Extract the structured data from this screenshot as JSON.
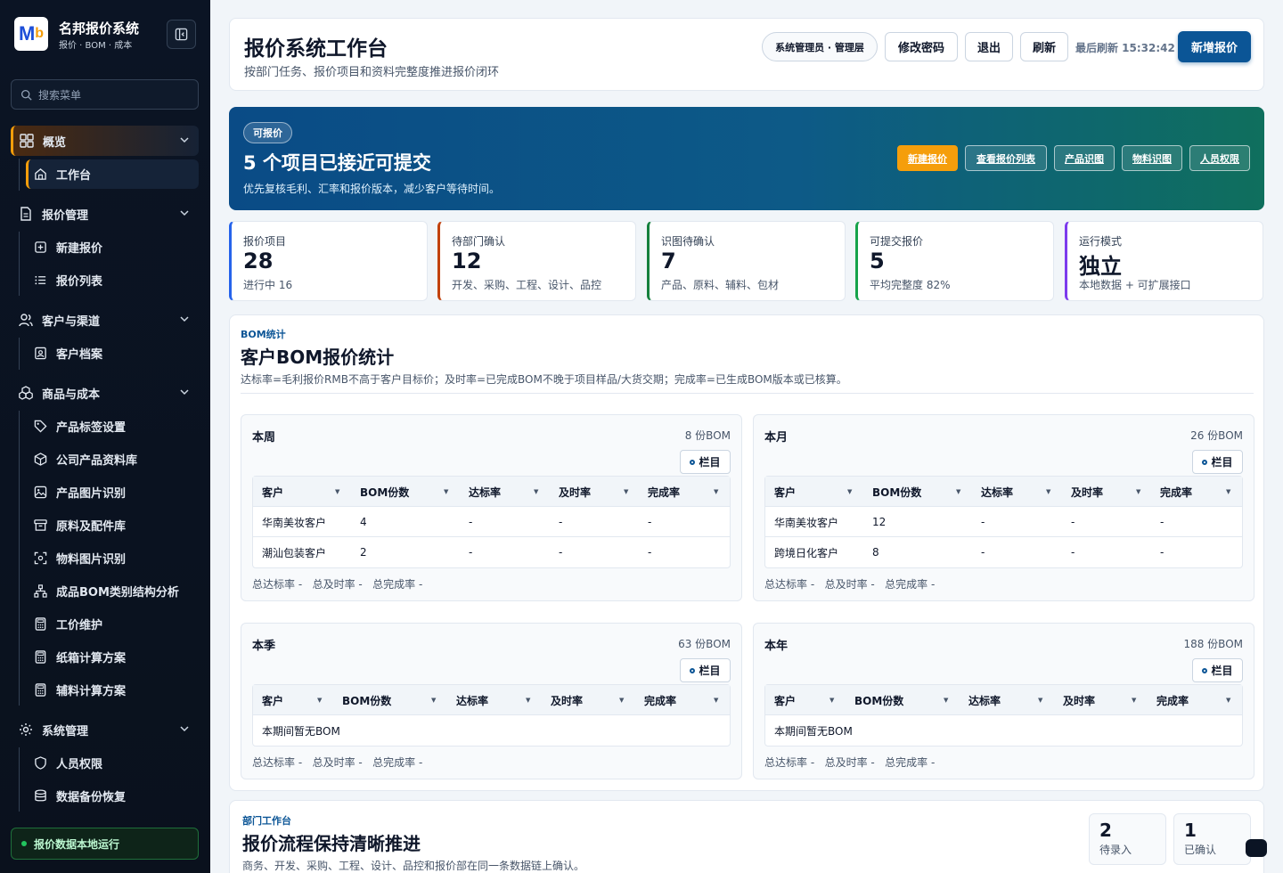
{
  "brand": {
    "name": "名邦报价系统",
    "sub": "报价 · BOM · 成本",
    "logo_main": "M",
    "logo_accent": "b"
  },
  "search": {
    "placeholder": "搜索菜单"
  },
  "nav": {
    "overview": "概览",
    "workbench": "工作台",
    "quote_mgmt": "报价管理",
    "new_quote": "新建报价",
    "quote_list": "报价列表",
    "customer": "客户与渠道",
    "customer_files": "客户档案",
    "goods": "商品与成本",
    "tags": "产品标签设置",
    "product_lib": "公司产品资料库",
    "product_img": "产品图片识别",
    "materials": "原料及配件库",
    "material_img": "物料图片识别",
    "bom_analysis": "成品BOM类别结构分析",
    "labor": "工价维护",
    "carton": "纸箱计算方案",
    "aux": "辅料计算方案",
    "system": "系统管理",
    "perm": "人员权限",
    "backup": "数据备份恢复"
  },
  "status_footer": "报价数据本地运行",
  "header": {
    "title": "报价系统工作台",
    "subtitle": "按部门任务、报价项目和资料完整度推进报价闭环",
    "role": "系统管理员 · 管理层",
    "change_pwd": "修改密码",
    "logout": "退出",
    "refresh": "刷新",
    "refresh_time": "最后刷新 15:32:42",
    "new_quote": "新增报价"
  },
  "hero": {
    "pill": "可报价",
    "title": "5 个项目已接近可提交",
    "subtitle": "优先复核毛利、汇率和报价版本，减少客户等待时间。",
    "buttons": [
      "新建报价",
      "查看报价列表",
      "产品识图",
      "物料识图",
      "人员权限"
    ]
  },
  "stats": [
    {
      "label": "报价项目",
      "value": "28",
      "note": "进行中 16",
      "color": "#2563eb"
    },
    {
      "label": "待部门确认",
      "value": "12",
      "note": "开发、采购、工程、设计、品控",
      "color": "#c2410c"
    },
    {
      "label": "识图待确认",
      "value": "7",
      "note": "产品、原料、辅料、包材",
      "color": "#15803d"
    },
    {
      "label": "可提交报价",
      "value": "5",
      "note": "平均完整度 82%",
      "color": "#16a34a"
    },
    {
      "label": "运行模式",
      "value": "独立",
      "note": "本地数据 + 可扩展接口",
      "color": "#7c3aed"
    }
  ],
  "bom": {
    "kicker": "BOM统计",
    "title": "客户BOM报价统计",
    "desc": "达标率=毛利报价RMB不高于客户目标价；及时率=已完成BOM不晚于项目样品/大货交期；完成率=已生成BOM版本或已核算。",
    "columns_btn": "栏目",
    "headers": [
      "客户",
      "BOM份数",
      "达标率",
      "及时率",
      "完成率"
    ],
    "summary": "总达标率 -   总及时率 -   总完成率 -",
    "panels": [
      {
        "title": "本周",
        "count": "8 份BOM",
        "rows": [
          [
            "华南美妆客户",
            "4",
            "-",
            "-",
            "-"
          ],
          [
            "潮汕包装客户",
            "2",
            "-",
            "-",
            "-"
          ]
        ]
      },
      {
        "title": "本月",
        "count": "26 份BOM",
        "rows": [
          [
            "华南美妆客户",
            "12",
            "-",
            "-",
            "-"
          ],
          [
            "跨境日化客户",
            "8",
            "-",
            "-",
            "-"
          ]
        ]
      },
      {
        "title": "本季",
        "count": "63 份BOM",
        "empty": "本期间暂无BOM"
      },
      {
        "title": "本年",
        "count": "188 份BOM",
        "empty": "本期间暂无BOM"
      }
    ]
  },
  "dept": {
    "kicker": "部门工作台",
    "title": "报价流程保持清晰推进",
    "desc": "商务、开发、采购、工程、设计、品控和报价部在同一条数据链上确认。",
    "boxes": [
      {
        "value": "2",
        "label": "待录入"
      },
      {
        "value": "1",
        "label": "已确认"
      }
    ]
  }
}
